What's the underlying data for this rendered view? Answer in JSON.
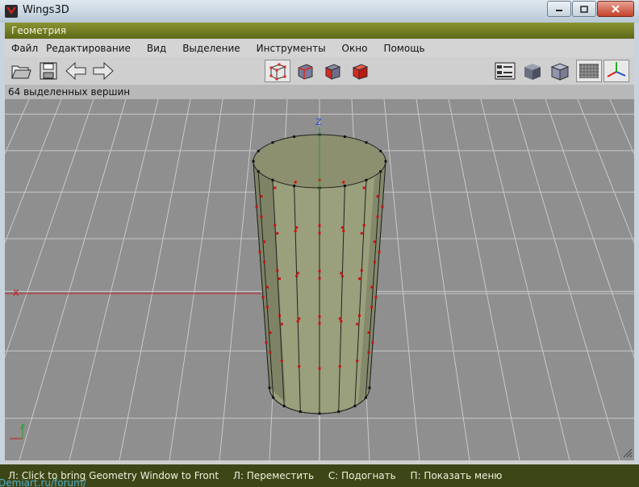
{
  "window": {
    "title": "Wings3D",
    "app_icon": "wings-logo-icon",
    "controls": [
      "minimize-icon",
      "maximize-icon",
      "close-icon"
    ]
  },
  "geometry_window": {
    "title": "Геометрия"
  },
  "menubar": {
    "items": [
      "Файл",
      "Редактирование",
      "Вид",
      "Выделение",
      "Инструменты",
      "Окно",
      "Помощь"
    ]
  },
  "toolbar": {
    "file_buttons": [
      "open-folder-icon",
      "save-disk-icon",
      "undo-arrow-icon",
      "redo-arrow-icon"
    ],
    "selection_modes": [
      "vertex-mode-icon",
      "edge-mode-icon",
      "face-mode-icon",
      "object-mode-icon"
    ],
    "active_selection_mode": "vertex-mode-icon",
    "view_buttons": [
      "info-panel-icon",
      "smooth-preview-icon",
      "perspective-cube-icon",
      "ground-grid-icon",
      "axes-icon"
    ],
    "colors": {
      "object_mode": "#d92a20",
      "axis_x": "#d22020",
      "axis_y": "#20b020",
      "axis_z": "#2050d0"
    }
  },
  "info_line": "64 выделенных вершин",
  "viewport": {
    "background": "#8f8f8f",
    "grid_color": "#c9c9c9",
    "axis_labels": {
      "x": "X",
      "z": "Z"
    },
    "selected_vertex_color": "#cc1111",
    "mesh_color": "#9a9f7c"
  },
  "statusbar": {
    "items": [
      "Л: Click to bring Geometry Window to Front",
      "Л: Переместить",
      "С: Подогнать",
      "П: Показать меню"
    ]
  },
  "watermark": "Demiart.ru/forum/"
}
